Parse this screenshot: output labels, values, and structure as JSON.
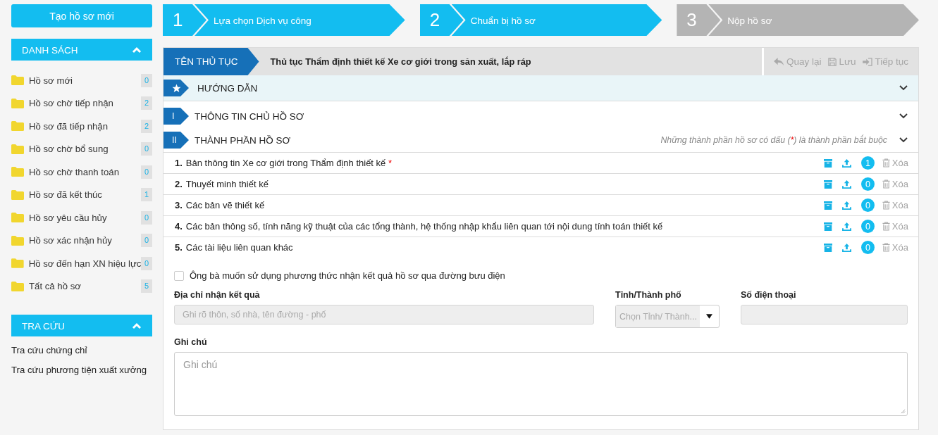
{
  "sidebar": {
    "create_button": "Tạo hồ sơ mới",
    "list_section": {
      "title": "DANH SÁCH",
      "expanded": true,
      "items": [
        {
          "label": "Hồ sơ mới",
          "count": "0"
        },
        {
          "label": "Hồ sơ chờ tiếp nhận",
          "count": "2"
        },
        {
          "label": "Hồ sơ đã tiếp nhận",
          "count": "2"
        },
        {
          "label": "Hồ sơ chờ bổ sung",
          "count": "0"
        },
        {
          "label": "Hồ sơ chờ thanh toán",
          "count": "0"
        },
        {
          "label": "Hồ sơ đã kết thúc",
          "count": "1"
        },
        {
          "label": "Hồ sơ yêu cầu hủy",
          "count": "0"
        },
        {
          "label": "Hồ sơ xác nhận hủy",
          "count": "0"
        },
        {
          "label": "Hồ sơ đến hạn XN hiệu lực",
          "count": "0"
        },
        {
          "label": "Tất cả hồ sơ",
          "count": "5"
        }
      ]
    },
    "lookup_section": {
      "title": "TRA CỨU",
      "expanded": true,
      "links": [
        "Tra cứu chứng chỉ",
        "Tra cứu phương tiện xuất xưởng"
      ]
    }
  },
  "steps": [
    {
      "number": "1",
      "label": "Lựa chọn Dịch vụ công",
      "active": true
    },
    {
      "number": "2",
      "label": "Chuẩn bị hồ sơ",
      "active": true
    },
    {
      "number": "3",
      "label": "Nộp hồ sơ",
      "active": false
    }
  ],
  "procedure": {
    "label": "TÊN THỦ TỤC",
    "name": "Thủ tục Thẩm định thiết kế Xe cơ giới trong sản xuất, lắp ráp",
    "actions": [
      {
        "kind": "back",
        "label": "Quay lại"
      },
      {
        "kind": "save",
        "label": "Lưu"
      },
      {
        "kind": "next",
        "label": "Tiếp tục"
      }
    ]
  },
  "sections": [
    {
      "title": "HƯỚNG DẪN",
      "highlighted": true
    },
    {
      "marker": "I",
      "title": "THÔNG TIN CHỦ HỒ SƠ",
      "highlighted": false
    },
    {
      "marker": "II",
      "title": "THÀNH PHẦN HỒ SƠ",
      "highlighted": false,
      "note": [
        "Những thành phần hồ sơ có dấu (",
        "*",
        ") là thành phần bắt buộc"
      ]
    }
  ],
  "required_mark": "*",
  "documents": [
    {
      "number": "1.",
      "title": "Bản thông tin Xe cơ giới trong Thẩm định thiết kế",
      "required": true,
      "file_count": "1",
      "delete_label": "Xóa"
    },
    {
      "number": "2.",
      "title": "Thuyết minh thiết kế",
      "required": false,
      "file_count": "0",
      "delete_label": "Xóa"
    },
    {
      "number": "3.",
      "title": "Các bản vẽ thiết kế",
      "required": false,
      "file_count": "0",
      "delete_label": "Xóa"
    },
    {
      "number": "4.",
      "title": "Các bản thông số, tính năng kỹ thuật của các tổng thành, hệ thống nhập khẩu liên quan tới nội dung tính toán thiết kế",
      "required": false,
      "file_count": "0",
      "delete_label": "Xóa"
    },
    {
      "number": "5.",
      "title": "Các tài liệu liên quan khác",
      "required": false,
      "file_count": "0",
      "delete_label": "Xóa"
    }
  ],
  "form": {
    "postal_checkbox": {
      "label": "Ông bà muốn sử dụng phương thức nhận kết quả hồ sơ qua đường bưu điện",
      "checked": false
    },
    "address": {
      "label": "Địa chỉ nhận kết quả",
      "placeholder": "Ghi rõ thôn, số nhà, tên đường - phố"
    },
    "province": {
      "label": "Tỉnh/Thành phố",
      "placeholder": "Chọn Tỉnh/ Thành..."
    },
    "phone": {
      "label": "Số điện thoại"
    },
    "note": {
      "label": "Ghi chú",
      "placeholder": "Ghi chú"
    }
  }
}
